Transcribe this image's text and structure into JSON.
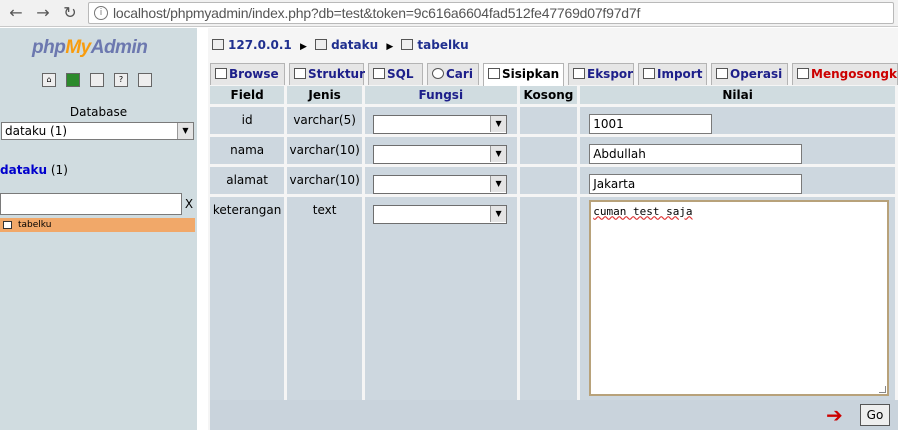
{
  "browser": {
    "url": "localhost/phpmyadmin/index.php?db=test&token=9c616a6604fad512fe47769d07f97d7f"
  },
  "sidebar": {
    "logo": {
      "part1": "php",
      "part2": "My",
      "part3": "Admin"
    },
    "database_label": "Database",
    "selected_database": "dataku (1)",
    "db_link_name": "dataku",
    "db_link_count": "(1)",
    "filter_clear": "X",
    "table_item": "tabelku"
  },
  "breadcrumb": {
    "server": "127.0.0.1",
    "database": "dataku",
    "table": "tabelku"
  },
  "tabs": [
    {
      "label": "Browse"
    },
    {
      "label": "Struktur"
    },
    {
      "label": "SQL"
    },
    {
      "label": "Cari"
    },
    {
      "label": "Sisipkan"
    },
    {
      "label": "Ekspor"
    },
    {
      "label": "Import"
    },
    {
      "label": "Operasi"
    },
    {
      "label": "Mengosongka"
    }
  ],
  "table": {
    "headers": {
      "field": "Field",
      "type": "Jenis",
      "function": "Fungsi",
      "null": "Kosong",
      "value": "Nilai"
    },
    "rows": [
      {
        "field": "id",
        "type": "varchar(5)",
        "value": "1001"
      },
      {
        "field": "nama",
        "type": "varchar(10)",
        "value": "Abdullah"
      },
      {
        "field": "alamat",
        "type": "varchar(10)",
        "value": "Jakarta"
      },
      {
        "field": "keterangan",
        "type": "text",
        "value": "cuman test saja"
      }
    ]
  },
  "actions": {
    "go_label": "Go"
  },
  "colors": {
    "accent_blue": "#1d1f8a",
    "danger_red": "#cc0000",
    "sidebar_bg": "#d0dce0",
    "highlight_orange": "#f1a869"
  }
}
